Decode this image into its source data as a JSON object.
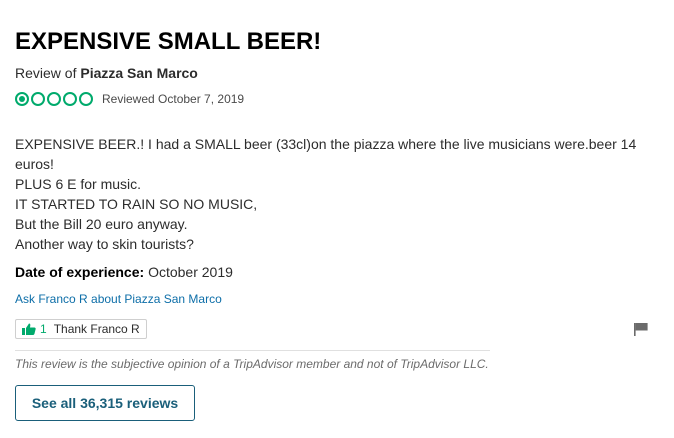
{
  "review": {
    "title": "EXPENSIVE SMALL BEER!",
    "review_of_prefix": "Review of",
    "place_name": "Piazza San Marco",
    "rating": {
      "value": 1,
      "max": 5,
      "color": "#00aa6c"
    },
    "reviewed_date": "Reviewed October 7, 2019",
    "body_lines": [
      "EXPENSIVE BEER.! I had a SMALL beer (33cl)on the piazza where the live musicians were.beer 14 euros!",
      "PLUS 6 E for music.",
      "IT STARTED TO RAIN SO NO MUSIC,",
      "But the Bill 20 euro anyway.",
      "Another way to skin tourists?"
    ],
    "date_of_experience_label": "Date of experience:",
    "date_of_experience_value": "October 2019",
    "ask_link": "Ask Franco R about Piazza San Marco",
    "thank": {
      "count": "1",
      "label": "Thank Franco R",
      "icon": "thumbs-up-icon"
    },
    "flag_icon": "flag-icon",
    "disclaimer": "This review is the subjective opinion of a TripAdvisor member and not of TripAdvisor LLC.",
    "see_all_button": "See all 36,315 reviews"
  },
  "colors": {
    "accent_green": "#00aa6c",
    "link_blue": "#0d6ea8",
    "button_teal": "#1a5f7a"
  }
}
